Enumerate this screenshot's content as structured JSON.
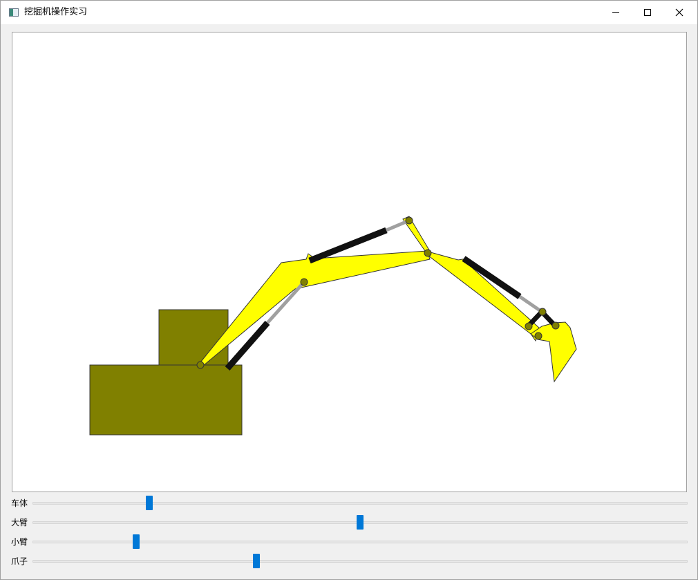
{
  "window": {
    "title": "挖掘机操作实习",
    "icon": "app-window-icon",
    "controls": [
      "minimize-icon",
      "maximize-icon",
      "close-icon"
    ]
  },
  "colors": {
    "body": "#808000",
    "arm": "#ffff00",
    "cylinder": "#111111",
    "rod": "#a0a0a0",
    "joint": "#808000",
    "slider_thumb": "#0078d7"
  },
  "sliders": [
    {
      "label": "车体",
      "value": 0.175
    },
    {
      "label": "大臂",
      "value": 0.5
    },
    {
      "label": "小臂",
      "value": 0.155
    },
    {
      "label": "爪子",
      "value": 0.34
    }
  ]
}
